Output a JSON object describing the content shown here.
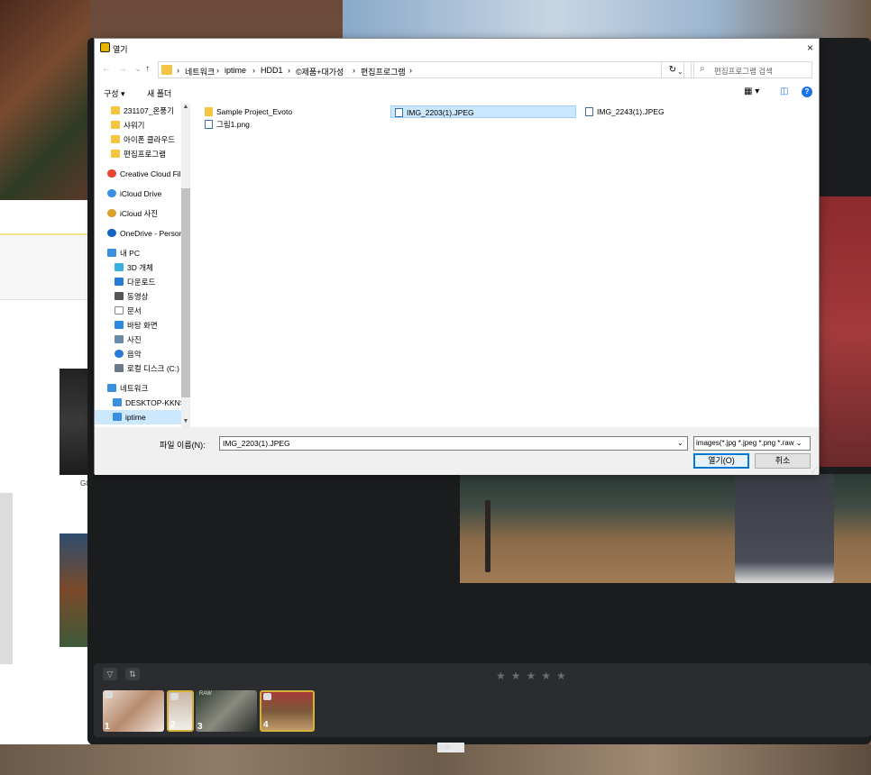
{
  "dialog": {
    "title": "열기",
    "close": "×",
    "nav": {
      "back": "←",
      "forward": "→",
      "recent": "⌄",
      "up": "↑"
    },
    "breadcrumb": [
      "›",
      "네트워크",
      "›",
      "iptime",
      "›",
      "HDD1",
      "›",
      "©제품+대가성",
      "›",
      "편집프로그램",
      "›"
    ],
    "address_dropdown": "⌄",
    "refresh": "↻",
    "search_placeholder": "편집프로그램 검색",
    "toolbar": {
      "organize": "구성 ▾",
      "new_folder": "새 폴더",
      "view": "▦ ▾",
      "pane": "◫",
      "help": "?"
    },
    "nav_pane": [
      {
        "label": "231107_온풍기",
        "color": "#f4c542"
      },
      {
        "label": "샤워기",
        "color": "#f4c542"
      },
      {
        "label": "아이폰 클라우드",
        "color": "#f4c542"
      },
      {
        "label": "편집프로그램",
        "color": "#f4c542"
      },
      {
        "label": "Creative Cloud Fil",
        "color": "#e8452c"
      },
      {
        "label": "iCloud Drive",
        "color": "#3a8fe0"
      },
      {
        "label": "iCloud 사진",
        "color": "#d9a12e"
      },
      {
        "label": "OneDrive - Person",
        "color": "#1266c2"
      },
      {
        "label": "내 PC",
        "color": "#3a8fe0"
      },
      {
        "label": "3D 개체",
        "color": "#3ab0e0"
      },
      {
        "label": "다운로드",
        "color": "#2a7ad9"
      },
      {
        "label": "동영상",
        "color": "#555"
      },
      {
        "label": "문서",
        "color": "#888"
      },
      {
        "label": "바탕 화면",
        "color": "#2a8ae0"
      },
      {
        "label": "사진",
        "color": "#6a8aaa"
      },
      {
        "label": "음악",
        "color": "#2a7ad9"
      },
      {
        "label": "로컬 디스크 (C:)",
        "color": "#6a7a8a"
      },
      {
        "label": "네트워크",
        "color": "#3a8fe0"
      },
      {
        "label": "DESKTOP-KKNS",
        "color": "#3a8fe0"
      },
      {
        "label": "iptime",
        "color": "#3a8fe0"
      }
    ],
    "files": [
      {
        "name": "Sample Project_Evoto",
        "type": "folder"
      },
      {
        "name": "그림1.png",
        "type": "image"
      },
      {
        "name": "IMG_2203(1).JPEG",
        "type": "image"
      },
      {
        "name": "IMG_2243(1).JPEG",
        "type": "image"
      }
    ],
    "filename_label": "파일 이름(N):",
    "filename_value": "IMG_2203(1).JPEG",
    "filename_dropdown": "⌄",
    "filetype": "images(*.jpg *.jpeg *.png *.raw ⌄",
    "open_button": "열기(O)",
    "cancel_button": "취소",
    "grip": "⋰"
  },
  "app": {
    "filter_icon": "▽",
    "sort_icon": "⇅",
    "stars": "★★★★★",
    "thumbnails": [
      {
        "num": "1",
        "raw": ""
      },
      {
        "num": "2",
        "raw": ""
      },
      {
        "num": "3",
        "raw": "RAW"
      },
      {
        "num": "4",
        "raw": ""
      }
    ],
    "view_icons": "▤▣"
  },
  "web_page": {
    "caption": "Gl"
  }
}
